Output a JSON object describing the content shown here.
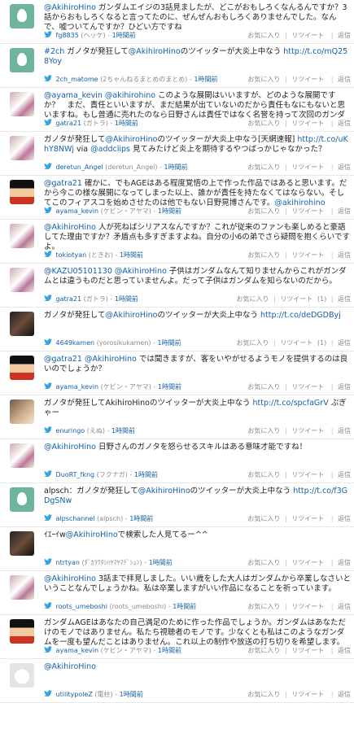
{
  "actions": {
    "fav": "お気に入り",
    "rt": "リツイート",
    "reply": "返信",
    "sep": "|"
  },
  "tweets": [
    {
      "avatar": "egg",
      "parts": [
        {
          "t": "@AkihiroHino",
          "l": true
        },
        {
          "t": " ガンダムエイジの3話見ましたが、どこがおもしろくなんるんですか？3話からおもしろくなると言ってたのに、ぜんぜんおもしろくありませんでした。なんで、嘘ついてんですか？ひどい方ですね"
        }
      ],
      "user": "fg8835",
      "name": "(ヘッケ)",
      "time": "1時間前",
      "rt_count": ""
    },
    {
      "avatar": "egg",
      "parts": [
        {
          "t": "#2ch",
          "l": true
        },
        {
          "t": " ガノタが発狂して"
        },
        {
          "t": "@AkihiroHino",
          "l": true
        },
        {
          "t": "のツイッターが大炎上中なう "
        },
        {
          "t": "http://t.co/mQ258Yoy",
          "l": true
        }
      ],
      "user": "2ch_matome",
      "name": "(2ちゃんねるまとめのまとめ)",
      "time": "1時間前",
      "rt_count": ""
    },
    {
      "avatar": "anime",
      "parts": [
        {
          "t": "@ayama_kevin",
          "l": true
        },
        {
          "t": " "
        },
        {
          "t": "@akihirohino",
          "l": true
        },
        {
          "t": " このような展開はいいますが、どのような展開ですか？　まだ、責任といいますが、まだ結果が出ていないのだから責任もなにもないと思いますね。もし普通に売れたのなら日野さんは責任ではなく名誉を持って次回のガンダムの制作に関わりますよ。"
        }
      ],
      "user": "gatra21",
      "name": "(ガトラ)",
      "time": "1時間前",
      "rt_count": ""
    },
    {
      "avatar": "anime",
      "parts": [
        {
          "t": "ガノタが発狂して"
        },
        {
          "t": "@AkihiroHino",
          "l": true
        },
        {
          "t": "のツイッターが大炎上中なう[天網速報] "
        },
        {
          "t": "http://t.co/uKhY8NWj",
          "l": true
        },
        {
          "t": " via "
        },
        {
          "t": "@addclips",
          "l": true
        },
        {
          "t": " 見てみたけど炎上を期待するやつばっかじゃなかった？"
        }
      ],
      "user": "deretun_Angel",
      "name": "(deretun_Angel)",
      "time": "1時間前",
      "rt_count": ""
    },
    {
      "avatar": "kid",
      "parts": [
        {
          "t": "@gatra21",
          "l": true
        },
        {
          "t": " 確かに、でもAGEはある程度覚悟の上で作った作品ではあると思います。だから今この様な展開になってしまった以上、誰かが責任を持たなくてはならない。そしてこのフィアスコを始めさせたのは他でもない日野晃博さんです。"
        },
        {
          "t": "@akihirohino",
          "l": true
        }
      ],
      "user": "ayama_kevin",
      "name": "(ケビン・アヤマ)",
      "time": "1時間前",
      "rt_count": ""
    },
    {
      "avatar": "anime",
      "parts": [
        {
          "t": "@AkihiroHino",
          "l": true
        },
        {
          "t": " 人が死ねばシリアスなんですか？これが従来のファンも楽しめると豪語してた理由ですか？矛盾点も多すぎますよね。自分の小6の弟でさら疑問を抱くらいですよ。"
        }
      ],
      "user": "tokiotyan",
      "name": "(ときお)",
      "time": "1時間前",
      "rt_count": ""
    },
    {
      "avatar": "anime",
      "parts": [
        {
          "t": "@KAZU05101130",
          "l": true
        },
        {
          "t": " "
        },
        {
          "t": "@AkihiroHino",
          "l": true
        },
        {
          "t": " 子供はガンダムなんて知りませんからこれがガンダムとは違うものだと思っていませんよ。だって子供はガンダムを知らないのだから。"
        }
      ],
      "user": "gatra21",
      "name": "(ガトラ)",
      "time": "1時間前",
      "rt_count": "(1)"
    },
    {
      "avatar": "dark",
      "parts": [
        {
          "t": "ガノタが発狂して"
        },
        {
          "t": "@AkihiroHino",
          "l": true
        },
        {
          "t": "のツイッターが大炎上中なう "
        },
        {
          "t": "http://t.co/deDGDByj",
          "l": true
        }
      ],
      "user": "4649kamen",
      "name": "(yorosikukamen)",
      "time": "1時間前",
      "rt_count": "(1)"
    },
    {
      "avatar": "kid",
      "parts": [
        {
          "t": "@gatra21",
          "l": true
        },
        {
          "t": " "
        },
        {
          "t": "@AkihiroHino",
          "l": true
        },
        {
          "t": " では聞きますが、客をいやがせるようモノを提供するのは良いのでしょうか？"
        }
      ],
      "user": "ayama_kevin",
      "name": "(ケビン・アヤマ)",
      "time": "1時間前",
      "rt_count": ""
    },
    {
      "avatar": "photo",
      "parts": [
        {
          "t": "ガノタが発狂してAkihiroHinoのツイッターが大炎上中なう "
        },
        {
          "t": "http://t.co/spcfaGrV",
          "l": true
        },
        {
          "t": " ぶぎゃー"
        }
      ],
      "user": "enuringo",
      "name": "(えぬ)",
      "time": "1時間前",
      "rt_count": ""
    },
    {
      "avatar": "anime",
      "parts": [
        {
          "t": "@AkihiroHino",
          "l": true
        },
        {
          "t": " 日野さんのガノタを怒らせるスキルはある意味才能ですね！"
        }
      ],
      "user": "DuoRT_fkng",
      "name": "(フクナガ)",
      "time": "1時間前",
      "rt_count": ""
    },
    {
      "avatar": "egg",
      "parts": [
        {
          "t": "alpsch：ガノタが発狂して"
        },
        {
          "t": "@AkihiroHino",
          "l": true
        },
        {
          "t": "のツイッターが大炎上中なう "
        },
        {
          "t": "http://t.co/f3GDgSNw",
          "l": true
        }
      ],
      "user": "alpschannel",
      "name": "(alpsch)",
      "time": "1時間前",
      "rt_count": ""
    },
    {
      "avatar": "dark",
      "parts": [
        {
          "t": "ｲｴｰｲw"
        },
        {
          "t": "@AkihiroHino",
          "l": true
        },
        {
          "t": "で検索した人見てるー^^"
        }
      ],
      "user": "ntrtyan",
      "name": "(ﾀﾞｶﾗﾜﾀｼﾊﾔﾏﾔﾏﾃﾞｼｮﾝ)",
      "time": "1時間前",
      "rt_count": ""
    },
    {
      "avatar": "anime",
      "parts": [
        {
          "t": "@AkihiroHino",
          "l": true
        },
        {
          "t": " 3話まで拝見しました。いい歳をした大人はガンダムから卒業しなさいということなんでしょうかね。私は卒業しますがいい作品になることを祈っています。"
        }
      ],
      "user": "roots_umeboshi",
      "name": "(roots_umeboshi)",
      "time": "1時間前",
      "rt_count": ""
    },
    {
      "avatar": "kid",
      "parts": [
        {
          "t": "ガンダムAGEはあなたの自己満足のために作った作品でしょうか。ガンダムはあなただけのモノではありません。私たち視聴者のモノです。少なくとも私はこのようなガンダムを一度も望んだことはありません。これ以上の制作や放送の打ち切りを希望します。"
        },
        {
          "t": "@AkihiroHino",
          "l": true
        }
      ],
      "user": "ayama_kevin",
      "name": "(ケビン・アヤマ)",
      "time": "1時間前",
      "rt_count": ""
    },
    {
      "avatar": "ghost",
      "parts": [
        {
          "t": "@AkihiroHino",
          "l": true
        }
      ],
      "user": "utilitypoleZ",
      "name": "(電柱)",
      "time": "1時間前",
      "rt_count": ""
    }
  ]
}
